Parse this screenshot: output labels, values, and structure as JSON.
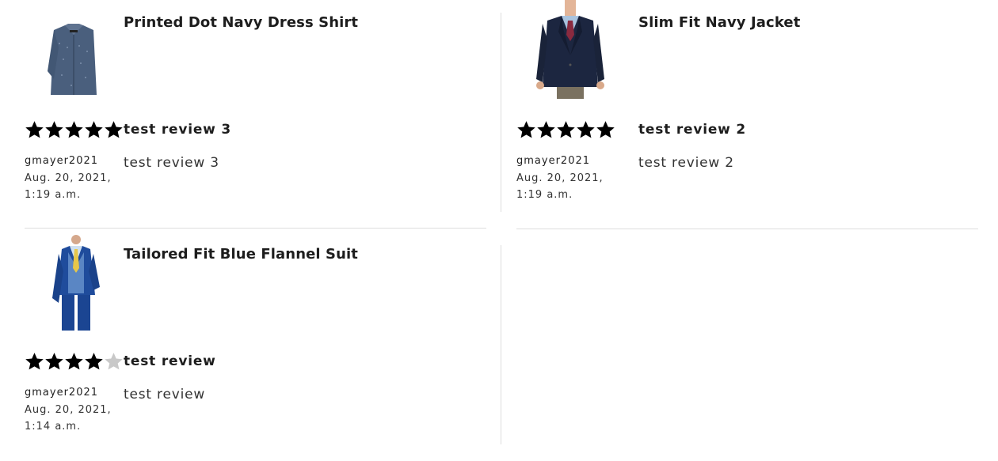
{
  "reviews": [
    {
      "product": "Printed Dot Navy Dress Shirt",
      "product_image": "navy-dotted-shirt",
      "rating": 5,
      "review_title": "test review 3",
      "review_body": "test review 3",
      "username": "gmayer2021",
      "date": "Aug. 20, 2021, 1:19 a.m."
    },
    {
      "product": "Slim Fit Navy Jacket",
      "product_image": "navy-blazer-model",
      "rating": 5,
      "review_title": "test review 2",
      "review_body": "test review 2",
      "username": "gmayer2021",
      "date": "Aug. 20, 2021, 1:19 a.m."
    },
    {
      "product": "Tailored Fit Blue Flannel Suit",
      "product_image": "blue-suit-model",
      "rating": 4,
      "review_title": "test review",
      "review_body": "test review",
      "username": "gmayer2021",
      "date": "Aug. 20, 2021, 1:14 a.m."
    }
  ],
  "rating_max": 5,
  "colors": {
    "star_filled": "#000000",
    "star_empty": "#c8c8c8",
    "divider": "#dddddd"
  }
}
